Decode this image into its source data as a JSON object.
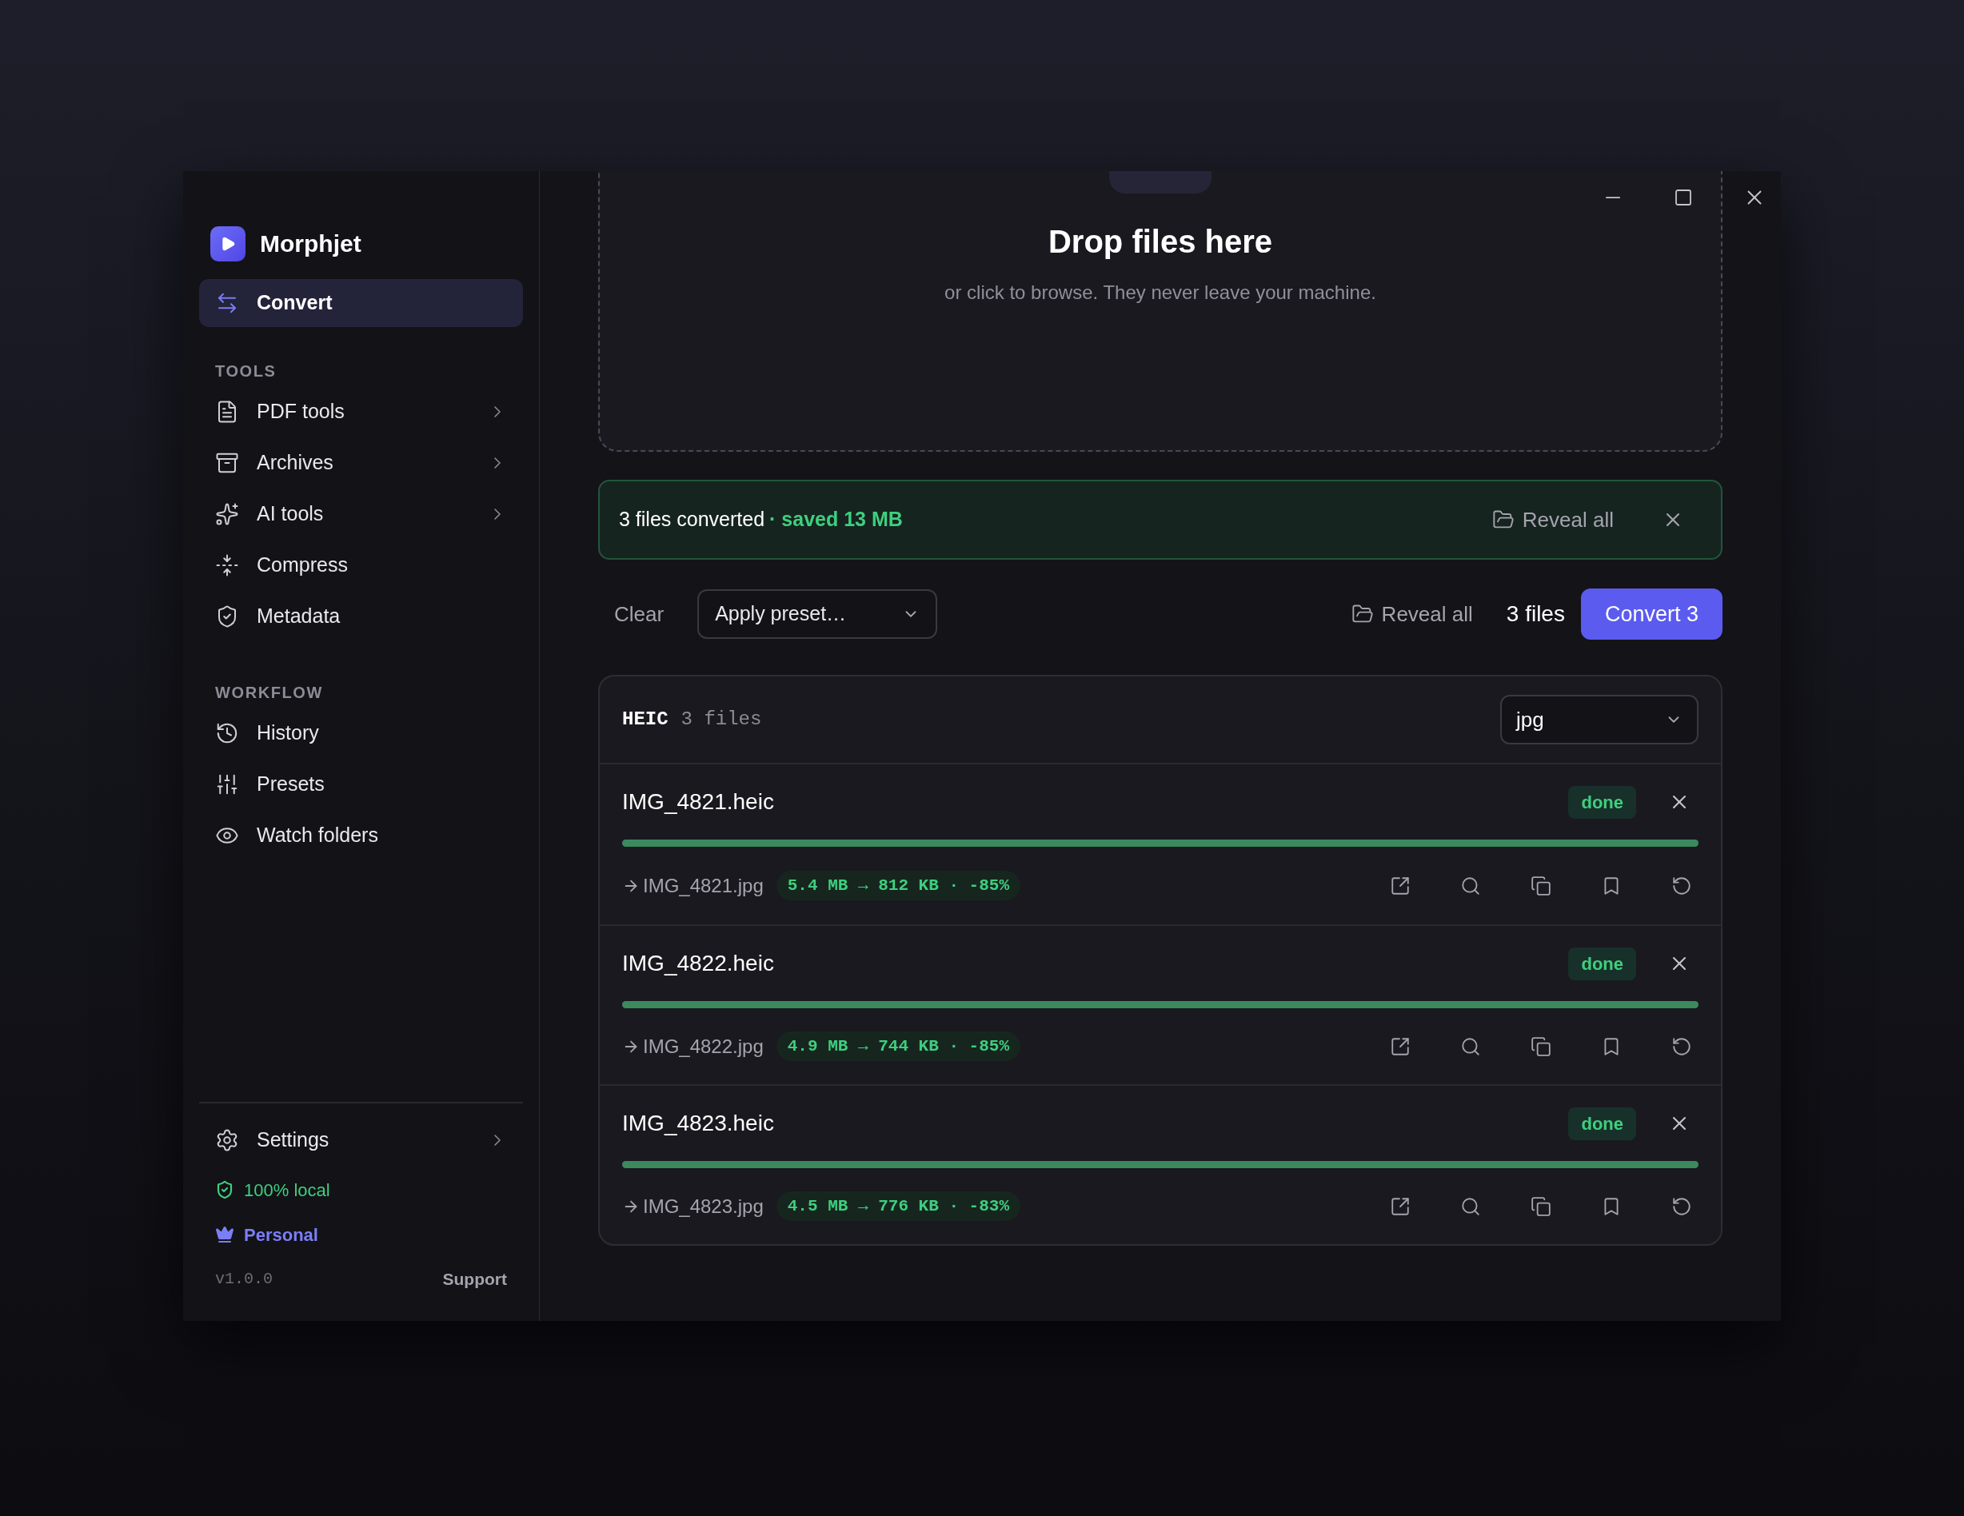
{
  "app": {
    "name": "Morphjet"
  },
  "sidebar": {
    "primary": [
      {
        "label": "Convert",
        "selected": true
      }
    ],
    "sections": [
      {
        "title": "TOOLS",
        "items": [
          {
            "label": "PDF tools",
            "selected": false,
            "submenu": true
          },
          {
            "label": "Archives",
            "selected": false,
            "submenu": true
          },
          {
            "label": "AI tools",
            "selected": false,
            "submenu": true
          },
          {
            "label": "Compress",
            "selected": false,
            "submenu": false
          },
          {
            "label": "Metadata",
            "selected": false,
            "submenu": false
          }
        ]
      },
      {
        "title": "WORKFLOW",
        "items": [
          {
            "label": "History",
            "selected": false,
            "submenu": false
          },
          {
            "label": "Presets",
            "selected": false,
            "submenu": false
          },
          {
            "label": "Watch folders",
            "selected": false,
            "submenu": false
          }
        ]
      }
    ],
    "footer": {
      "settings": {
        "label": "Settings",
        "submenu": true
      },
      "privacy": "100% local",
      "plan": "Personal",
      "version": "v1.0.0",
      "support": "Support"
    }
  },
  "dropzone": {
    "title": "Drop files here",
    "subtitle": "or click to browse. They never leave your machine."
  },
  "banner": {
    "message": "3 files converted",
    "saved": "· saved 13 MB",
    "action": "Reveal all"
  },
  "toolbar": {
    "clear": "Clear",
    "preset": {
      "placeholder": "Apply preset…"
    },
    "reveal": "Reveal all",
    "count": "3 files",
    "convert": "Convert 3"
  },
  "group": {
    "format": "HEIC",
    "count": "3 files",
    "output": "jpg",
    "files": [
      {
        "name": "IMG_4821.heic",
        "status": "done",
        "level": 1,
        "output": "IMG_4821.jpg",
        "stats": "5.4 MB → 812 KB · -85%"
      },
      {
        "name": "IMG_4822.heic",
        "status": "done",
        "level": 1,
        "output": "IMG_4822.jpg",
        "stats": "4.9 MB → 744 KB · -85%"
      },
      {
        "name": "IMG_4823.heic",
        "status": "done",
        "level": 1,
        "output": "IMG_4823.jpg",
        "stats": "4.5 MB → 776 KB · -83%"
      }
    ]
  }
}
